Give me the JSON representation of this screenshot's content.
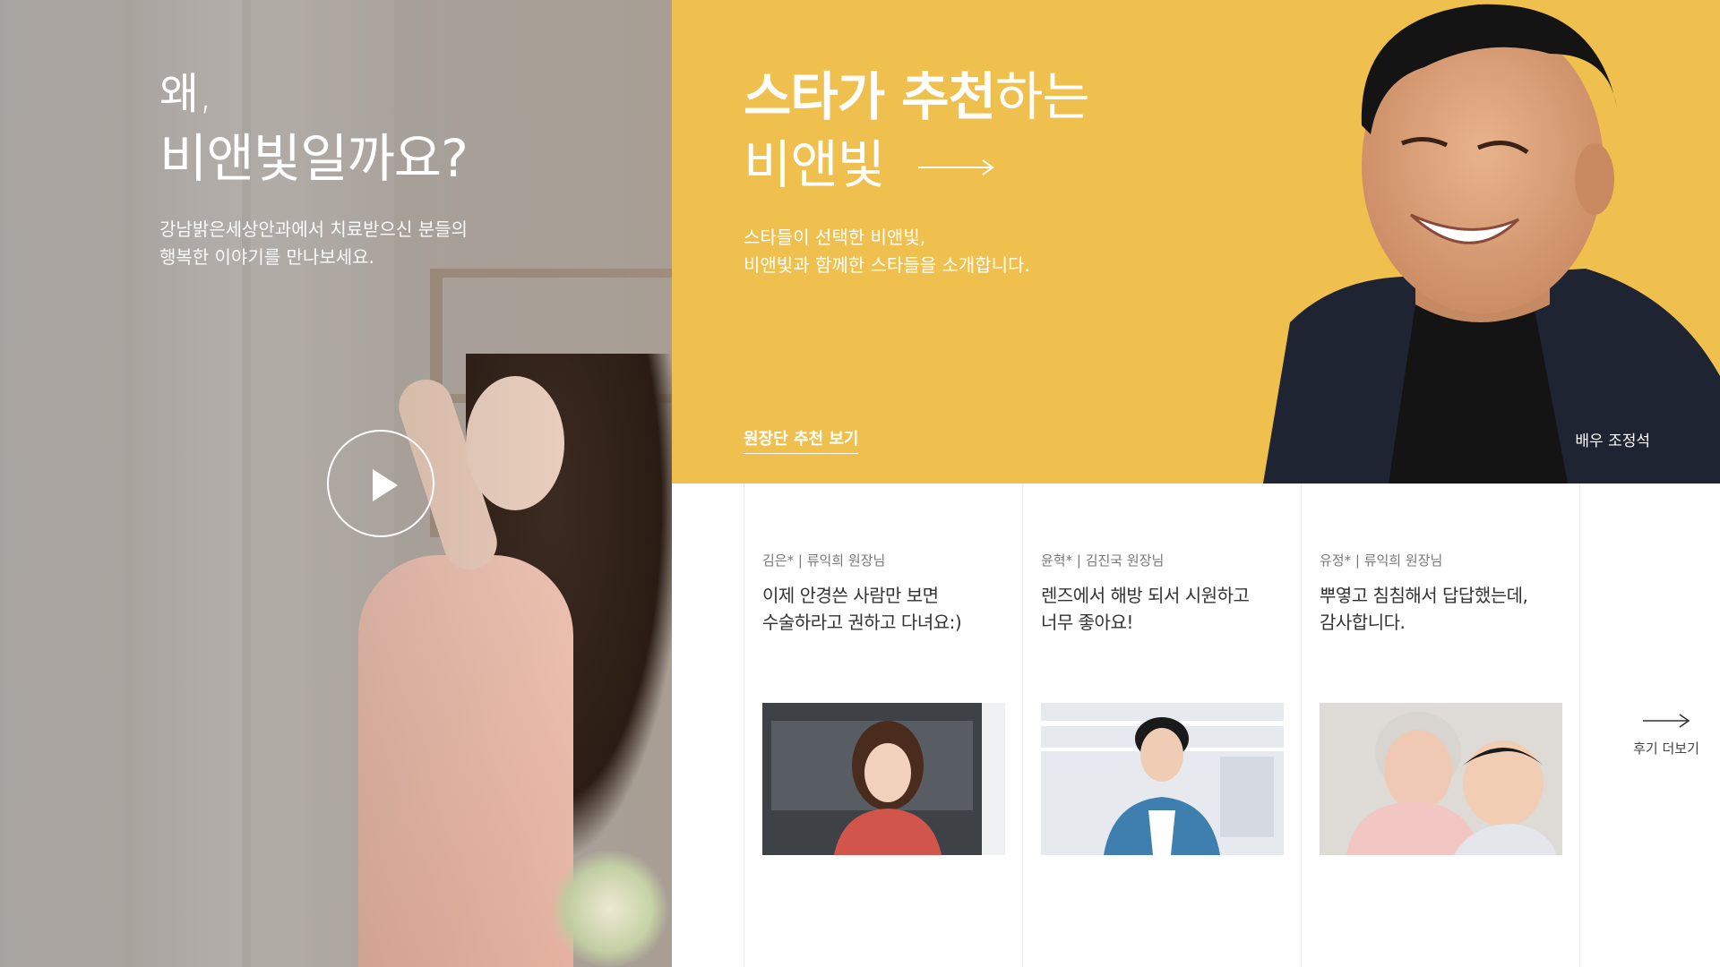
{
  "left": {
    "why": "왜,",
    "title": "비앤빛일까요?",
    "desc_line1": "강남밝은세상안과에서 치료받으신 분들의",
    "desc_line2": "행복한 이야기를 만나보세요.",
    "play_icon": "play-icon"
  },
  "star": {
    "title_bold": "스타가 추천",
    "title_light": "하는",
    "title_line2": "비앤빛",
    "desc_line1": "스타들이 선택한 비앤빛,",
    "desc_line2": "비앤빛과 함께한 스타들을 소개합니다.",
    "link": "원장단 추천 보기",
    "caption": "배우 조정석",
    "colors": {
      "background": "#efc04e"
    }
  },
  "reviews": [
    {
      "meta": "김은* | 류익희 원장님",
      "quote_line1": "이제 안경쓴 사람만 보면",
      "quote_line2": "수술하라고 권하고 다녀요:)"
    },
    {
      "meta": "윤혁* | 김진국 원장님",
      "quote_line1": "렌즈에서 해방 되서 시원하고",
      "quote_line2": "너무 좋아요!"
    },
    {
      "meta": "유정* | 류익희 원장님",
      "quote_line1": "뿌옇고 침침해서 답답했는데,",
      "quote_line2": "감사합니다."
    }
  ],
  "more": {
    "label": "후기 더보기",
    "icon": "arrow-right-icon"
  }
}
